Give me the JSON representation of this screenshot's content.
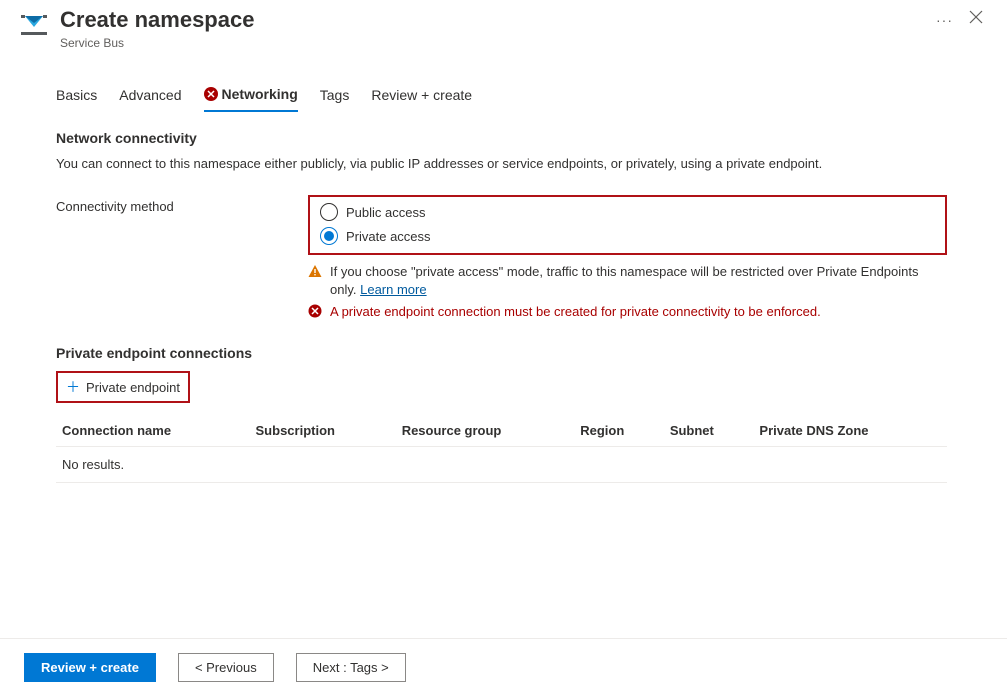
{
  "header": {
    "title": "Create namespace",
    "subtitle": "Service Bus"
  },
  "tabs": {
    "basics": "Basics",
    "advanced": "Advanced",
    "networking": "Networking",
    "tags": "Tags",
    "review": "Review + create",
    "active": "networking",
    "error_on": "networking"
  },
  "networking": {
    "section_title": "Network connectivity",
    "description": "You can connect to this namespace either publicly, via public IP addresses or service endpoints, or privately, using a private endpoint.",
    "connectivity_label": "Connectivity method",
    "options": {
      "public": "Public access",
      "private": "Private access"
    },
    "selected": "private",
    "warning_text": "If you choose \"private access\" mode, traffic to this namespace will be restricted over Private Endpoints only. ",
    "warning_link": "Learn more",
    "error_text": "A private endpoint connection must be created for private connectivity to be enforced."
  },
  "endpoints": {
    "section_title": "Private endpoint connections",
    "add_label": "Private endpoint",
    "columns": {
      "name": "Connection name",
      "subscription": "Subscription",
      "rg": "Resource group",
      "region": "Region",
      "subnet": "Subnet",
      "dns": "Private DNS Zone"
    },
    "empty": "No results."
  },
  "footer": {
    "review": "Review + create",
    "previous": "< Previous",
    "next": "Next : Tags >"
  }
}
